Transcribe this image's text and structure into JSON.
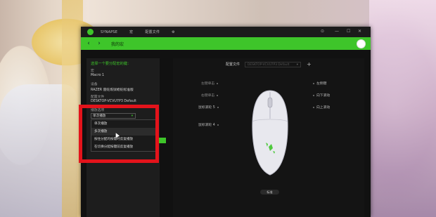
{
  "titlebar": {
    "items": [
      "SYNAPSE",
      "宏",
      "配置文件",
      "⚙"
    ],
    "controls": [
      "⊙",
      "—",
      "☐",
      "✕"
    ]
  },
  "header": {
    "back": "‹",
    "forward": "›",
    "title": "我的宏"
  },
  "left_panel": {
    "title": "选择一个要分配宏的键：",
    "lines": [
      {
        "label": "宏",
        "value": "Macro 1"
      },
      {
        "label": "设备",
        "value": "RAZER 雷蛇炼狱蝰蛇标准版"
      },
      {
        "label": "配置文件",
        "value": "DESKTOP-VCVU7P3 Default"
      },
      {
        "label": "播放选项",
        "value": ""
      }
    ],
    "select": {
      "value": "单次播放",
      "caret": "▾"
    },
    "dropdown": [
      "单次播放",
      "多次播放",
      "按住分配的按键时反复播放",
      "在切换分配按键前反复播放"
    ]
  },
  "main": {
    "profile_label": "配置文件",
    "profile_value": "DESKTOP-VCVU7P3 Default",
    "profile_caret": "▾",
    "plus": "+",
    "left_buttons": [
      "左键单击",
      "右键单击",
      "鼠标滚轮 5",
      "鼠标滚轮 4"
    ],
    "right_buttons": [
      "左侧键",
      "向下滚动",
      "向上滚动"
    ],
    "bottom_button": "标准"
  },
  "colors": {
    "accent": "#3ec52a",
    "highlight": "#e3131b"
  }
}
